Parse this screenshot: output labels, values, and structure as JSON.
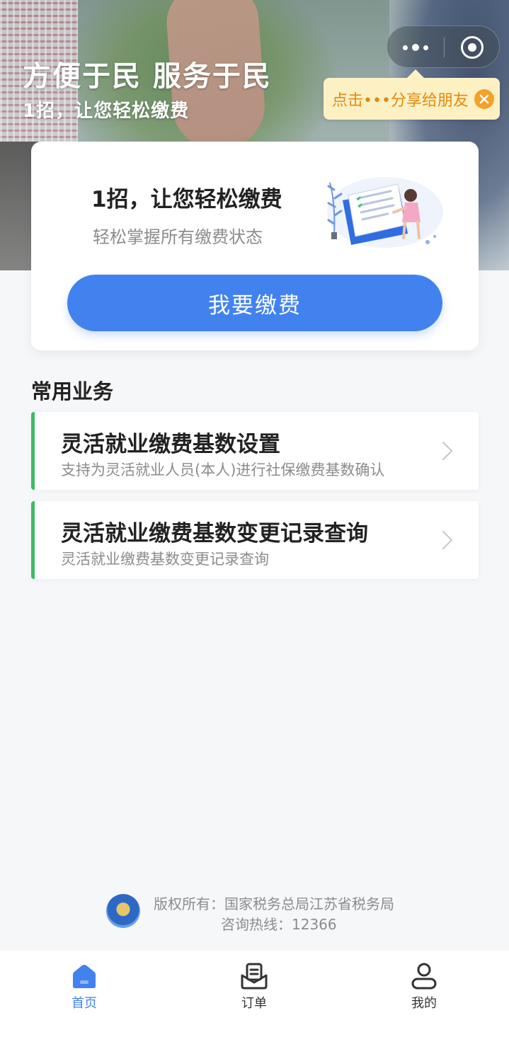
{
  "hero": {
    "title": "方便于民 服务于民",
    "subtitle": "1招，让您轻松缴费"
  },
  "capsule": {
    "more_icon": "more-dots-icon",
    "close_icon": "target-circle-icon"
  },
  "share_tip": {
    "text": "点击•••分享给朋友",
    "close_icon": "close-icon"
  },
  "card": {
    "title": "1招，让您轻松缴费",
    "description": "轻松掌握所有缴费状态",
    "button_label": "我要缴费",
    "accent_color": "#4282ee"
  },
  "services": {
    "section_title": "常用业务",
    "items": [
      {
        "title": "灵活就业缴费基数设置",
        "description": "支持为灵活就业人员(本人)进行社保缴费基数确认",
        "icon": "chevron-right-icon"
      },
      {
        "title": "灵活就业缴费基数变更记录查询",
        "description": "灵活就业缴费基数变更记录查询",
        "icon": "chevron-right-icon"
      }
    ],
    "accent_color": "#3dbb6a"
  },
  "footer": {
    "copyright": "版权所有：国家税务总局江苏省税务局",
    "hotline": "咨询热线：12366"
  },
  "tabbar": {
    "tabs": [
      {
        "label": "首页",
        "icon": "home-icon",
        "active": true
      },
      {
        "label": "订单",
        "icon": "order-icon",
        "active": false
      },
      {
        "label": "我的",
        "icon": "user-icon",
        "active": false
      }
    ],
    "active_color": "#4282ee"
  }
}
